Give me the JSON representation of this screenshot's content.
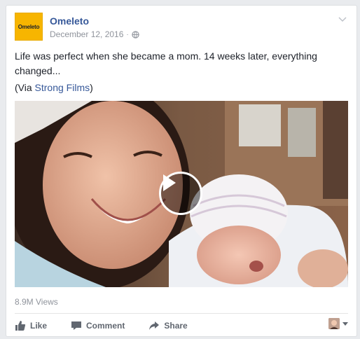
{
  "post": {
    "page_name": "Omeleto",
    "logo_text": "Omeleto",
    "date": "December 12, 2016",
    "privacy_icon": "globe-icon",
    "menu_icon": "chevron-down-icon",
    "text": "Life was perfect when she became a mom. 14 weeks later, everything changed...",
    "via_prefix": "(Via ",
    "via_link": "Strong Films",
    "via_suffix": ")"
  },
  "video": {
    "play_icon": "play-icon"
  },
  "stats": {
    "views": "8.9M Views"
  },
  "actions": {
    "like": "Like",
    "comment": "Comment",
    "share": "Share"
  },
  "colors": {
    "brand": "#365899",
    "logo_bg": "#f7b500",
    "meta": "#90949c",
    "action_text": "#616770"
  }
}
